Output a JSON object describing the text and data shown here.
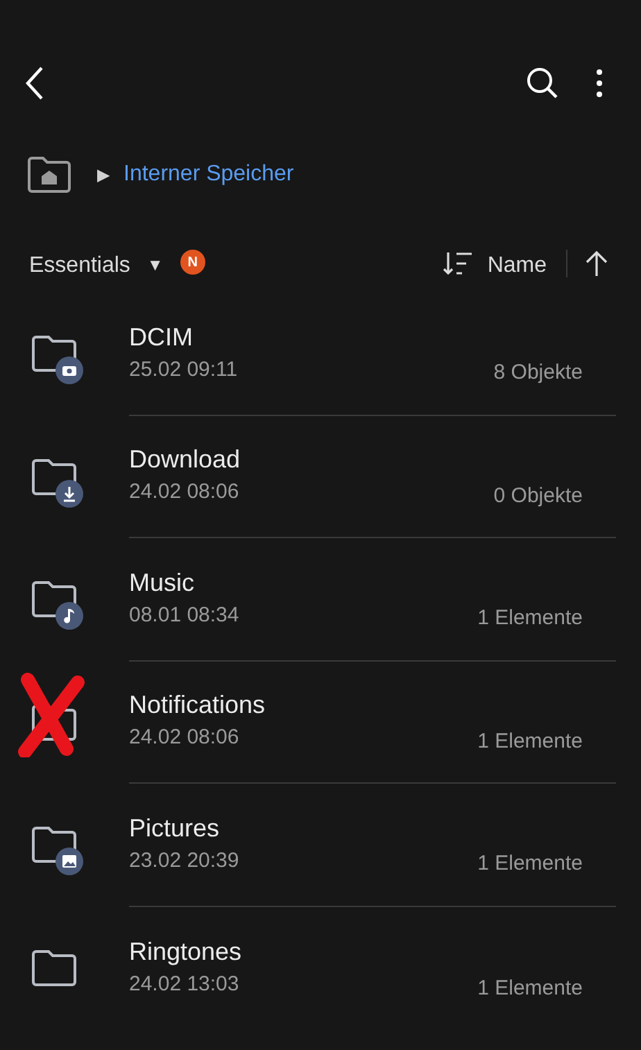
{
  "breadcrumb": {
    "separator": "▶",
    "label": "Interner Speicher"
  },
  "sort_bar": {
    "filter": "Essentials",
    "filter_caret": "▼",
    "badge": "N",
    "sort_label": "Name"
  },
  "folders": [
    {
      "name": "DCIM",
      "date": "25.02 09:11",
      "count": "8 Objekte",
      "kind": "camera",
      "crossed_out": false
    },
    {
      "name": "Download",
      "date": "24.02 08:06",
      "count": "0 Objekte",
      "kind": "download",
      "crossed_out": false
    },
    {
      "name": "Music",
      "date": "08.01 08:34",
      "count": "1 Elemente",
      "kind": "music",
      "crossed_out": false
    },
    {
      "name": "Notifications",
      "date": "24.02 08:06",
      "count": "1 Elemente",
      "kind": "plain",
      "crossed_out": true
    },
    {
      "name": "Pictures",
      "date": "23.02 20:39",
      "count": "1 Elemente",
      "kind": "image",
      "crossed_out": false
    },
    {
      "name": "Ringtones",
      "date": "24.02 13:03",
      "count": "1 Elemente",
      "kind": "plain",
      "crossed_out": false
    }
  ]
}
